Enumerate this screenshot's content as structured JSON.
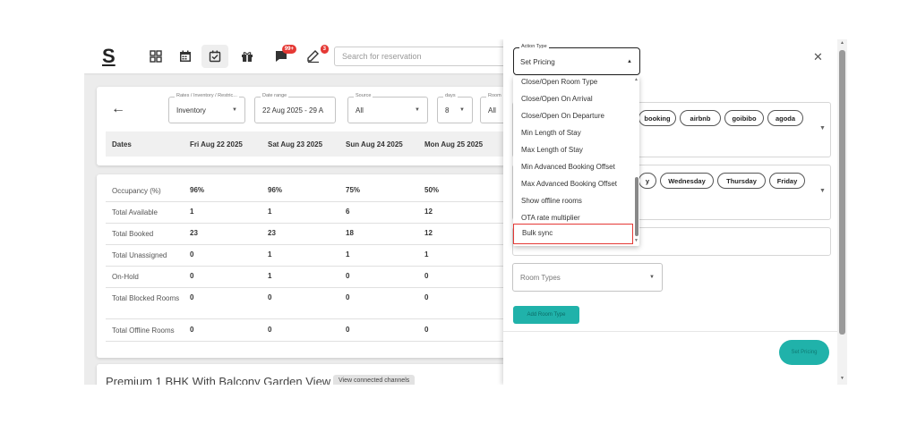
{
  "topbar": {
    "logo": "S",
    "icons": [
      "grid-icon",
      "calendar-icon",
      "calendar-check-icon",
      "gift-icon",
      "chat-icon",
      "edit-icon"
    ],
    "badges": {
      "chat": "99+",
      "edit": "3"
    },
    "search_placeholder": "Search for reservation"
  },
  "filters": {
    "rates_label": "Rates / Inventory / Restric...",
    "rates_value": "Inventory",
    "date_label": "Date range",
    "date_value": "22 Aug 2025 - 29 A",
    "source_label": "Source",
    "source_value": "All",
    "days_label": "days",
    "days_value": "8",
    "rooms_label": "Room",
    "rooms_value": "All"
  },
  "dates_header": {
    "label": "Dates",
    "columns": [
      "Fri Aug 22 2025",
      "Sat Aug 23 2025",
      "Sun Aug 24 2025",
      "Mon Aug 25 2025"
    ]
  },
  "stats": {
    "rows": [
      {
        "label": "Occupancy (%)",
        "values": [
          "96%",
          "96%",
          "75%",
          "50%"
        ]
      },
      {
        "label": "Total Available",
        "values": [
          "1",
          "1",
          "6",
          "12"
        ]
      },
      {
        "label": "Total Booked",
        "values": [
          "23",
          "23",
          "18",
          "12"
        ]
      },
      {
        "label": "Total Unassigned",
        "values": [
          "0",
          "1",
          "1",
          "1"
        ]
      },
      {
        "label": "On-Hold",
        "values": [
          "0",
          "1",
          "0",
          "0"
        ]
      },
      {
        "label": "Total Blocked Rooms",
        "values": [
          "0",
          "0",
          "0",
          "0"
        ]
      },
      {
        "label": "Total Offline Rooms",
        "values": [
          "0",
          "0",
          "0",
          "0"
        ]
      }
    ]
  },
  "room": {
    "title": "Premium 1 BHK With Balcony Garden View",
    "view_channels": "View connected channels"
  },
  "panel": {
    "action_type_label": "Action Type",
    "action_type_value": "Set Pricing",
    "options": [
      "Close/Open Room Type",
      "Close/Open On Arrival",
      "Close/Open On Departure",
      "Min Length of Stay",
      "Max Length of Stay",
      "Min Advanced Booking Offset",
      "Max Advanced Booking Offset",
      "Show offline rooms",
      "OTA rate multiplier",
      "Bulk sync"
    ],
    "highlighted_option": "Bulk sync",
    "channels": [
      "booking",
      "airbnb",
      "goibibo",
      "agoda"
    ],
    "days_visible": [
      "y",
      "Wednesday",
      "Thursday",
      "Friday"
    ],
    "room_types_placeholder": "Room Types",
    "add_room_type": "Add Room Type",
    "set_pricing_button": "Set Pricing"
  },
  "colors": {
    "accent": "#20b2aa",
    "badge": "#e53935",
    "highlight_border": "#e53935"
  }
}
